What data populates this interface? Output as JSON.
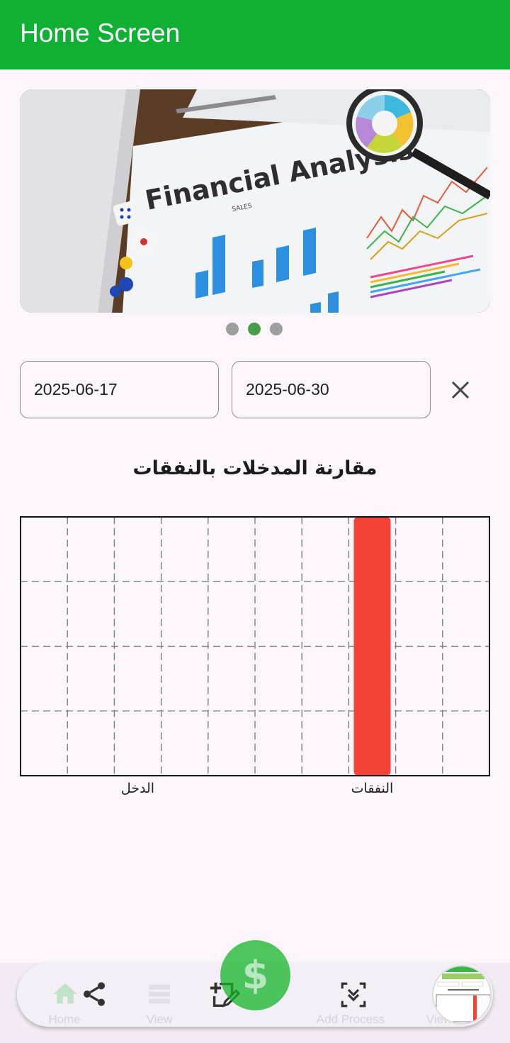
{
  "appbar": {
    "title": "Home Screen"
  },
  "banner": {
    "heading": "Financial Analysis",
    "sub": "SALES",
    "page_count": 3,
    "active_index": 1
  },
  "filters": {
    "start_date": "2025-06-17",
    "end_date": "2025-06-30"
  },
  "chart_data": {
    "type": "bar",
    "title": "مقارنة المدخلات بالنفقات",
    "categories": [
      "الدخل",
      "النفقات"
    ],
    "values": [
      0,
      1
    ],
    "colors": [
      "#f44336",
      "#f44336"
    ],
    "grid": true,
    "ylim": [
      0,
      1
    ]
  },
  "nav": {
    "items": [
      {
        "label": "Home",
        "icon": "home-icon"
      },
      {
        "label": "View",
        "icon": "list-icon"
      },
      {
        "label": "Add Process",
        "icon": "add-process-icon"
      },
      {
        "label": "View",
        "icon": "view-icon"
      }
    ],
    "fab_symbol": "$",
    "share_icon": "share-icon",
    "edit_icon": "edit-add-icon",
    "collapse_icon": "collapse-icon"
  }
}
